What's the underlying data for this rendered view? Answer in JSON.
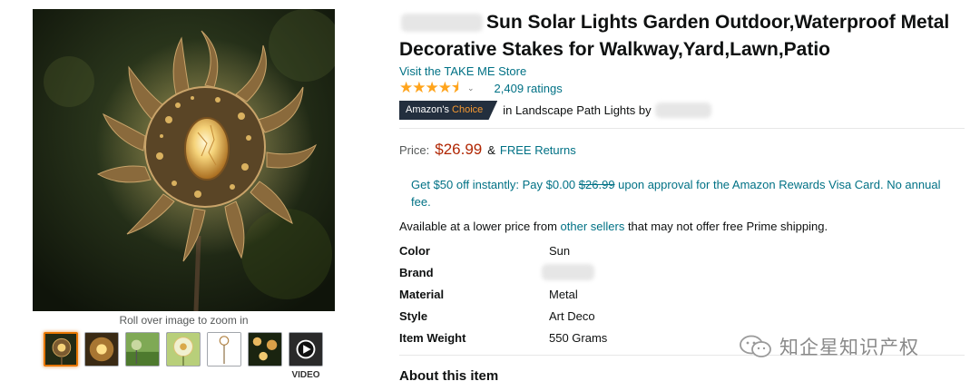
{
  "gallery": {
    "zoom_hint": "Roll over image to zoom in",
    "thumbnails": [
      {
        "name": "sun-stake-thumb",
        "selected": true
      },
      {
        "name": "sun-glow-thumb",
        "selected": false
      },
      {
        "name": "garden-thumb",
        "selected": false
      },
      {
        "name": "dandelion-thumb",
        "selected": false
      },
      {
        "name": "stake-outline-thumb",
        "selected": false
      },
      {
        "name": "night-lights-thumb",
        "selected": false
      },
      {
        "name": "video-thumb",
        "selected": false
      }
    ],
    "video_label": "VIDEO"
  },
  "product": {
    "title": "Sun Solar Lights Garden Outdoor,Waterproof Metal Decorative Stakes for Walkway,Yard,Lawn,Patio",
    "store_link": "Visit the TAKE ME Store",
    "rating_stars": "★★★★⯨",
    "rating_value": 4.5,
    "ratings_count": "2,409 ratings",
    "choice_badge_part1": "Amazon's ",
    "choice_badge_part2": "Choice",
    "choice_category": "in Landscape Path Lights by"
  },
  "pricing": {
    "price_label": "Price:",
    "price": "$26.99",
    "separator": "&",
    "free_returns": "FREE Returns",
    "promo_part1": "Get $50 off instantly: Pay $0.00 ",
    "promo_strike": "$26.99",
    "promo_part2": " upon approval for the Amazon Rewards Visa Card. No annual fee.",
    "lower_price_part1": "Available at a lower price from ",
    "lower_price_link": "other sellers",
    "lower_price_part2": " that may not offer free Prime shipping."
  },
  "specs": [
    {
      "key": "Color",
      "value": "Sun"
    },
    {
      "key": "Brand",
      "value": ""
    },
    {
      "key": "Material",
      "value": "Metal"
    },
    {
      "key": "Style",
      "value": "Art Deco"
    },
    {
      "key": "Item Weight",
      "value": "550 Grams"
    }
  ],
  "about_title": "About this item",
  "watermark": "知企星知识产权",
  "colors": {
    "link": "#007185",
    "price": "#b12704",
    "star": "#ffa41c",
    "badge_bg": "#232f3e",
    "badge_accent": "#f69931",
    "thumb_selected": "#e77600"
  }
}
